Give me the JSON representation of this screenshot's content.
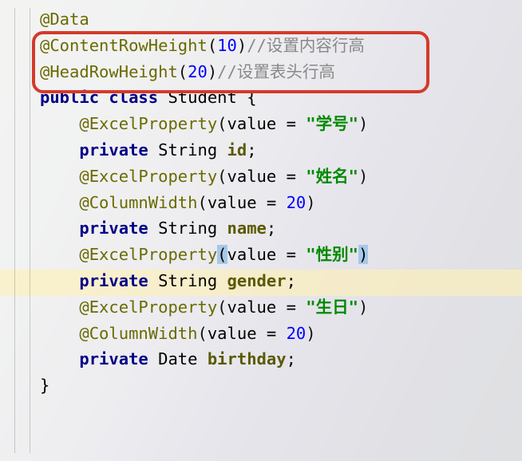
{
  "lines": {
    "l0_ann": "@Data",
    "l1_ann": "@ContentRowHeight",
    "l1_num": "10",
    "l1_cmt": "//设置内容行高",
    "l2_ann": "@HeadRowHeight",
    "l2_num": "20",
    "l2_cmt": "//设置表头行高",
    "l3_kw1": "public",
    "l3_kw2": "class",
    "l3_name": "Student",
    "l3_brace": "{",
    "l4_ann": "@ExcelProperty",
    "l4_param": "value = ",
    "l4_str": "\"学号\"",
    "l5_kw": "private",
    "l5_type": "String",
    "l5_id": "id",
    "l5_semi": ";",
    "l6_ann": "@ExcelProperty",
    "l6_param": "value = ",
    "l6_str": "\"姓名\"",
    "l7_ann": "@ColumnWidth",
    "l7_param": "value = ",
    "l7_num": "20",
    "l8_kw": "private",
    "l8_type": "String",
    "l8_id": "name",
    "l8_semi": ";",
    "l9_ann": "@ExcelProperty",
    "l9_param": "value = ",
    "l9_str": "\"性别\"",
    "l10_kw": "private",
    "l10_type": "String",
    "l10_id": "gender",
    "l10_semi": ";",
    "l11_ann": "@ExcelProperty",
    "l11_param": "value = ",
    "l11_str": "\"生日\"",
    "l12_ann": "@ColumnWidth",
    "l12_param": "value = ",
    "l12_num": "20",
    "l13_kw": "private",
    "l13_type": "Date",
    "l13_id": "birthday",
    "l13_semi": ";",
    "l14_brace": "}"
  }
}
